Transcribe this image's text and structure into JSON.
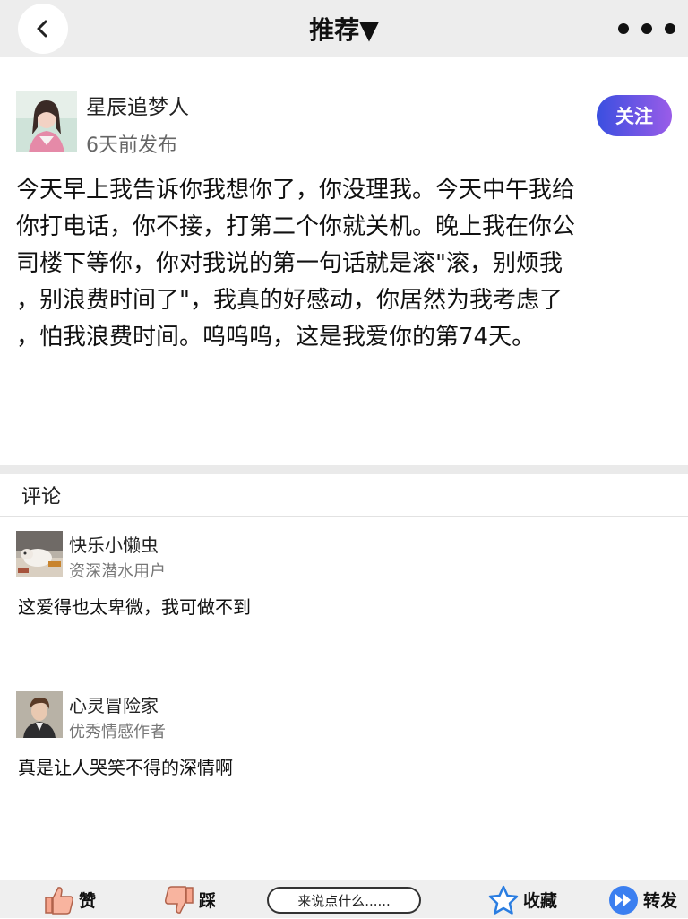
{
  "header": {
    "title": "推荐▼"
  },
  "post": {
    "author_name": "星辰追梦人",
    "time": "6天前发布",
    "follow_label": "关注",
    "content": "今天早上我告诉你我想你了，你没理我。今天中午我给\n你打电话，你不接，打第二个你就关机。晚上我在你公\n司楼下等你，你对我说的第一句话就是滚\"滚，别烦我\n，别浪费时间了\"，我真的好感动，你居然为我考虑了\n，怕我浪费时间。呜呜呜，这是我爱你的第74天。"
  },
  "comments_section": {
    "title": "评论",
    "items": [
      {
        "name": "快乐小懒虫",
        "tag": "资深潜水用户",
        "text": "这爱得也太卑微，我可做不到"
      },
      {
        "name": "心灵冒险家",
        "tag": "优秀情感作者",
        "text": "真是让人哭笑不得的深情啊"
      }
    ]
  },
  "bottom_bar": {
    "like_label": "赞",
    "dislike_label": "踩",
    "comment_placeholder": "来说点什么......",
    "favorite_label": "收藏",
    "share_label": "转发"
  },
  "colors": {
    "follow_gradient_start": "#3a4fe0",
    "follow_gradient_end": "#9a5ce8",
    "star_icon": "#2a7de1",
    "share_icon": "#3b7ff0",
    "thumb_icon": "#f6a48c"
  },
  "icons": [
    "back-arrow-icon",
    "more-dots-icon",
    "thumbs-up-icon",
    "thumbs-down-icon",
    "star-icon",
    "share-forward-icon"
  ]
}
